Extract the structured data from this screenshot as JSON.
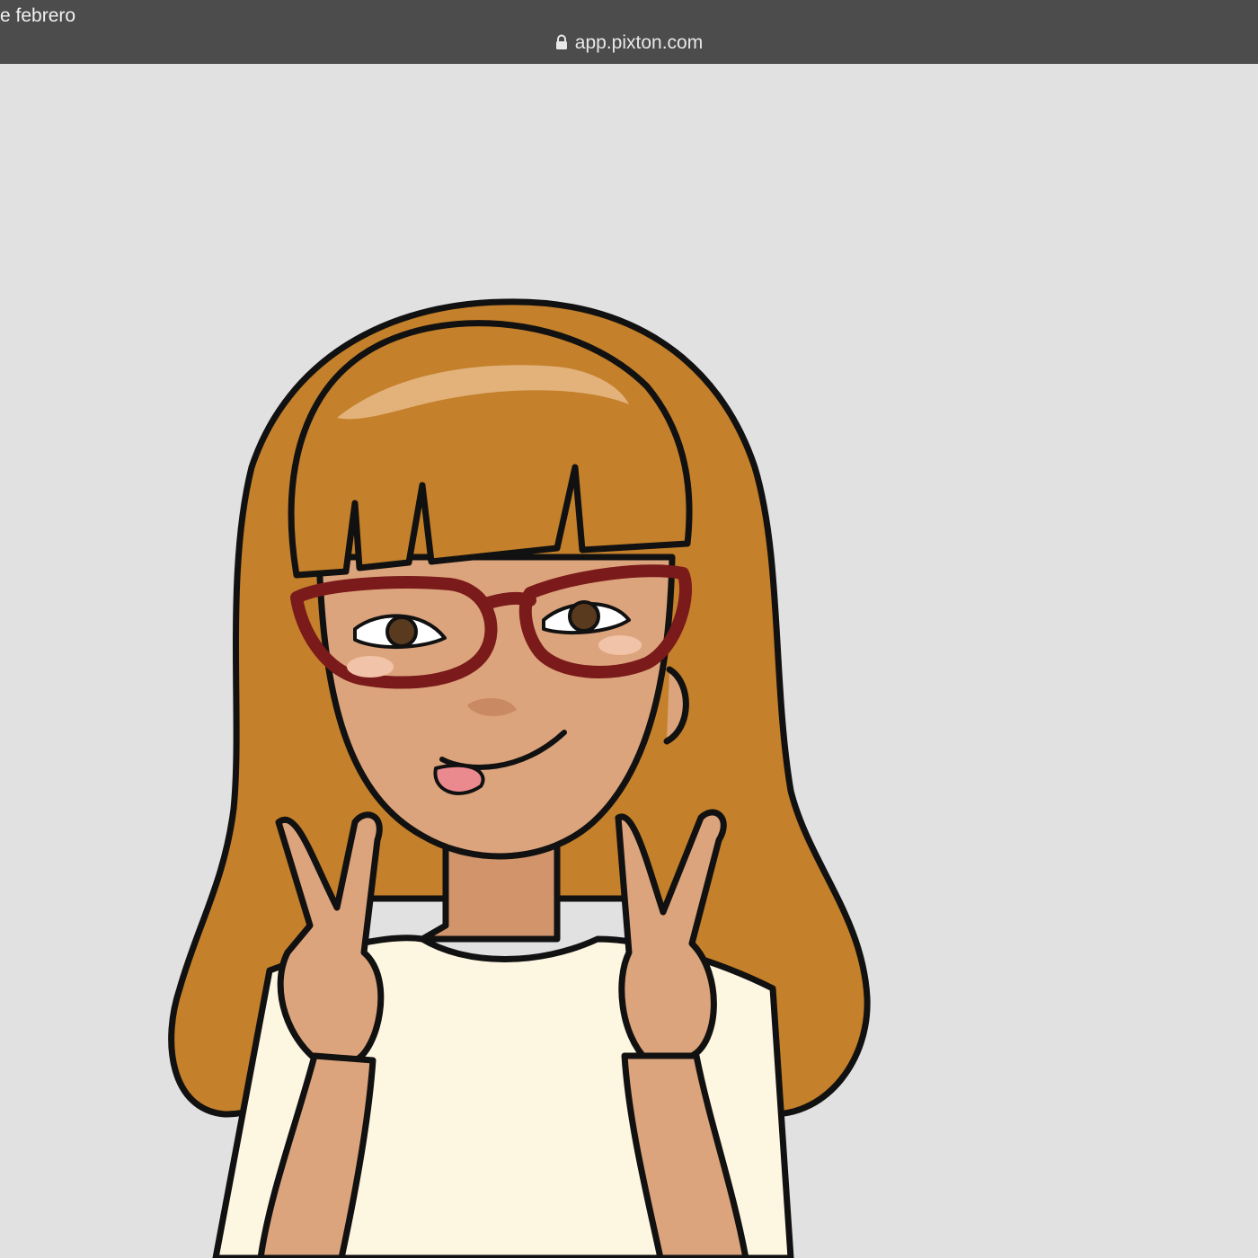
{
  "browser": {
    "tab_title": "e febrero",
    "url": "app.pixton.com",
    "lock_icon": "lock-icon"
  },
  "content": {
    "avatar": "pixton-avatar-girl-peace-sign",
    "colors": {
      "background": "#e1e1e1",
      "hair": "#c4802a",
      "hair_shadow": "#a3671f",
      "hair_highlight": "#e2b27a",
      "skin": "#dca47c",
      "glasses": "#7a1a1a",
      "shirt": "#fdf7e2",
      "tongue": "#eb8a8e",
      "outline": "#111111"
    }
  }
}
